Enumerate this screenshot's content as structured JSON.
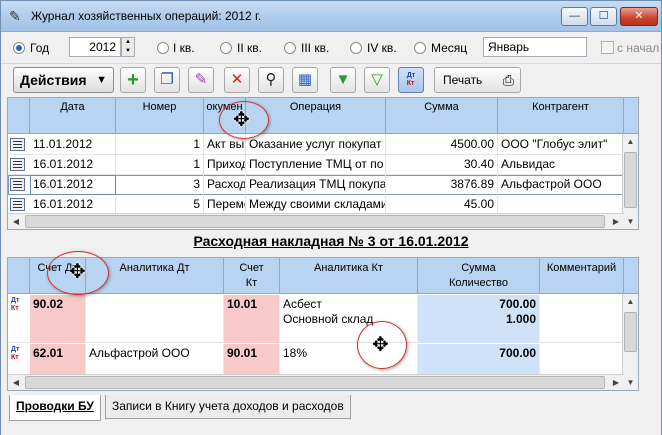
{
  "window": {
    "title": "Журнал хозяйственных операций: 2012 г.",
    "min_glyph": "—",
    "max_glyph": "☐",
    "close_glyph": "✕"
  },
  "period": {
    "options": [
      {
        "label": "Год",
        "checked": true
      },
      {
        "label": "I кв.",
        "checked": false
      },
      {
        "label": "II кв.",
        "checked": false
      },
      {
        "label": "III кв.",
        "checked": false
      },
      {
        "label": "IV кв.",
        "checked": false
      },
      {
        "label": "Месяц",
        "checked": false
      }
    ],
    "year_value": "2012",
    "month_value": "Январь",
    "from_start_label": "с начал"
  },
  "toolbar": {
    "actions_label": "Действия",
    "print_label": "Печать",
    "icons": [
      "add-icon",
      "copy-icon",
      "edit-icon",
      "delete-icon",
      "search-icon",
      "calendar-icon",
      "filter-icon",
      "clear-filter-icon",
      "dt-kt-icon",
      "printer-icon"
    ],
    "dt": "Дт",
    "kt": "Кт",
    "add_glyph": "+",
    "delete_glyph": "✕"
  },
  "journal": {
    "columns": [
      "Дата",
      "Номер",
      "окумен",
      "Операция",
      "Сумма",
      "Контрагент"
    ],
    "rows": [
      {
        "date": "11.01.2012",
        "number": "1",
        "doc": "Акт вы",
        "operation": "Оказание услуг покупат",
        "sum": "4500.00",
        "contractor": "ООО \"Глобус элит\""
      },
      {
        "date": "16.01.2012",
        "number": "1",
        "doc": "Приход",
        "operation": "Поступление ТМЦ от по",
        "sum": "30.40",
        "contractor": "Альвидас"
      },
      {
        "date": "16.01.2012",
        "number": "3",
        "doc": "Расход",
        "operation": "Реализация ТМЦ покупа",
        "sum": "3876.89",
        "contractor": "Альфастрой ООО"
      },
      {
        "date": "16.01.2012",
        "number": "5",
        "doc": "Переме",
        "operation": "Между своими складами",
        "sum": "45.00",
        "contractor": ""
      }
    ]
  },
  "document_title": "Расходная накладная № 3 от 16.01.2012",
  "entries": {
    "columns": {
      "debit_account": "Счет Дт",
      "analytics_dt": "Аналитика Дт",
      "credit_account": "Счет Кт",
      "analytics_kt": "Аналитика Кт",
      "sum_qty": "Сумма Количество",
      "comment": "Комментарий"
    },
    "rows": [
      {
        "dt": "90.02",
        "an_dt": "",
        "kt": "10.01",
        "an_kt_1": "Асбест",
        "an_kt_2": "Основной склад",
        "sum": "700.00",
        "qty": "1.000"
      },
      {
        "dt": "62.01",
        "an_dt": "Альфастрой ООО",
        "kt": "90.01",
        "an_kt_1": "18%",
        "an_kt_2": "",
        "sum": "700.00",
        "qty": ""
      }
    ]
  },
  "tabs": [
    {
      "label": "Проводки БУ",
      "active": true
    },
    {
      "label": "Записи в Книгу учета доходов и расходов",
      "active": false
    }
  ],
  "cursors": {
    "col_resize_glyph": "✥",
    "row_resize_glyph": "✥"
  },
  "colors": {
    "header_bg": "#b8d4f0",
    "debit_cell": "#f8c9c9",
    "sum_cell": "#cfe2f7",
    "cursor_ring": "#d43030"
  }
}
